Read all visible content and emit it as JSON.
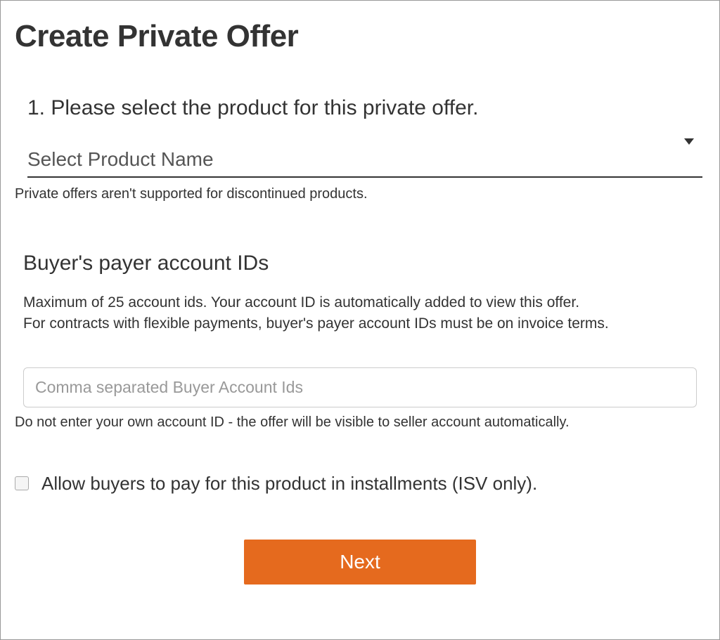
{
  "page": {
    "title": "Create Private Offer"
  },
  "step1": {
    "title": "1. Please select the product for this private offer.",
    "select_placeholder": "Select Product Name",
    "hint": "Private offers aren't supported for discontinued products."
  },
  "buyer_section": {
    "title": "Buyer's payer account IDs",
    "description_line1": "Maximum of 25 account ids. Your account ID is automatically added to view this offer.",
    "description_line2": "For contracts with flexible payments, buyer's payer account IDs must be on invoice terms.",
    "input_placeholder": "Comma separated Buyer Account Ids",
    "input_hint": "Do not enter your own account ID - the offer will be visible to seller account automatically."
  },
  "installments": {
    "label": "Allow buyers to pay for this product in installments (ISV only)."
  },
  "actions": {
    "next": "Next"
  }
}
